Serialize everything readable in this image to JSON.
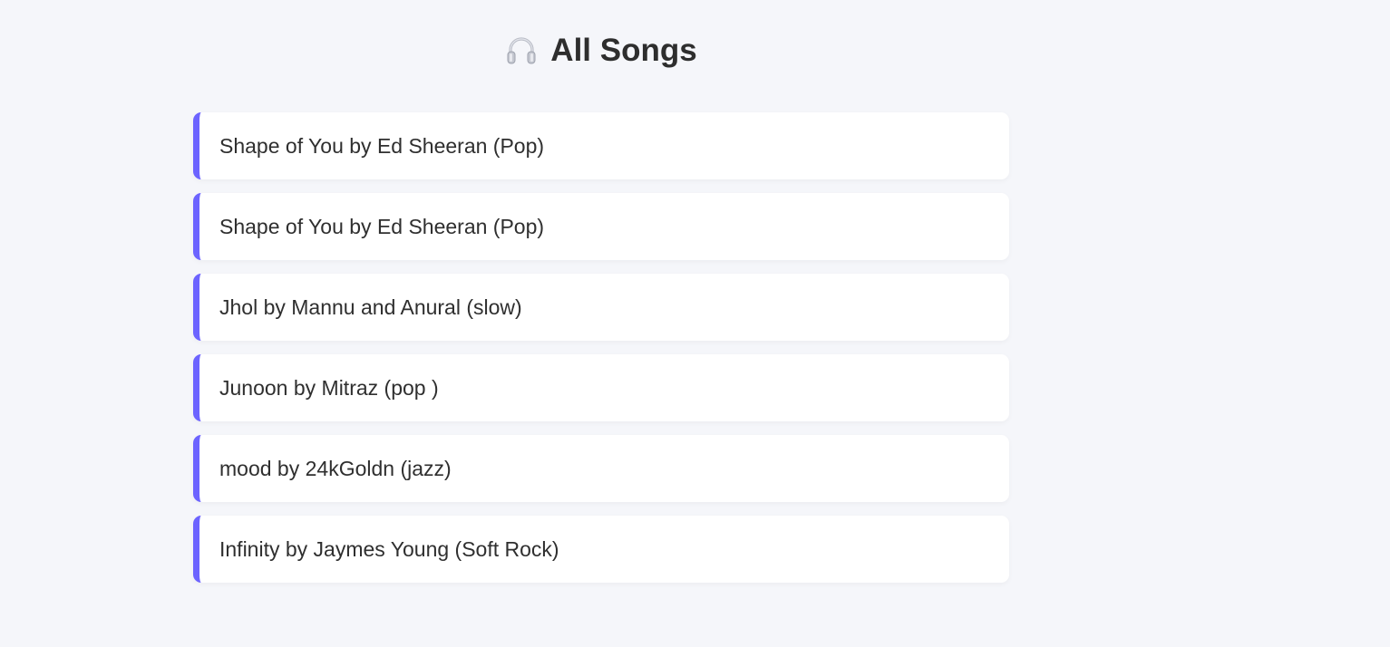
{
  "header": {
    "icon": "headphones-icon",
    "title": "All Songs"
  },
  "colors": {
    "accent": "#6c63ff",
    "background": "#f5f6fa",
    "card": "#ffffff",
    "text": "#2f2f2f"
  },
  "songs": [
    {
      "text": "Shape of You by Ed Sheeran (Pop)"
    },
    {
      "text": "Shape of You by Ed Sheeran (Pop)"
    },
    {
      "text": "Jhol by Mannu and Anural (slow)"
    },
    {
      "text": "Junoon by Mitraz (pop )"
    },
    {
      "text": "mood by 24kGoldn (jazz)"
    },
    {
      "text": "Infinity by Jaymes Young (Soft Rock)"
    }
  ]
}
